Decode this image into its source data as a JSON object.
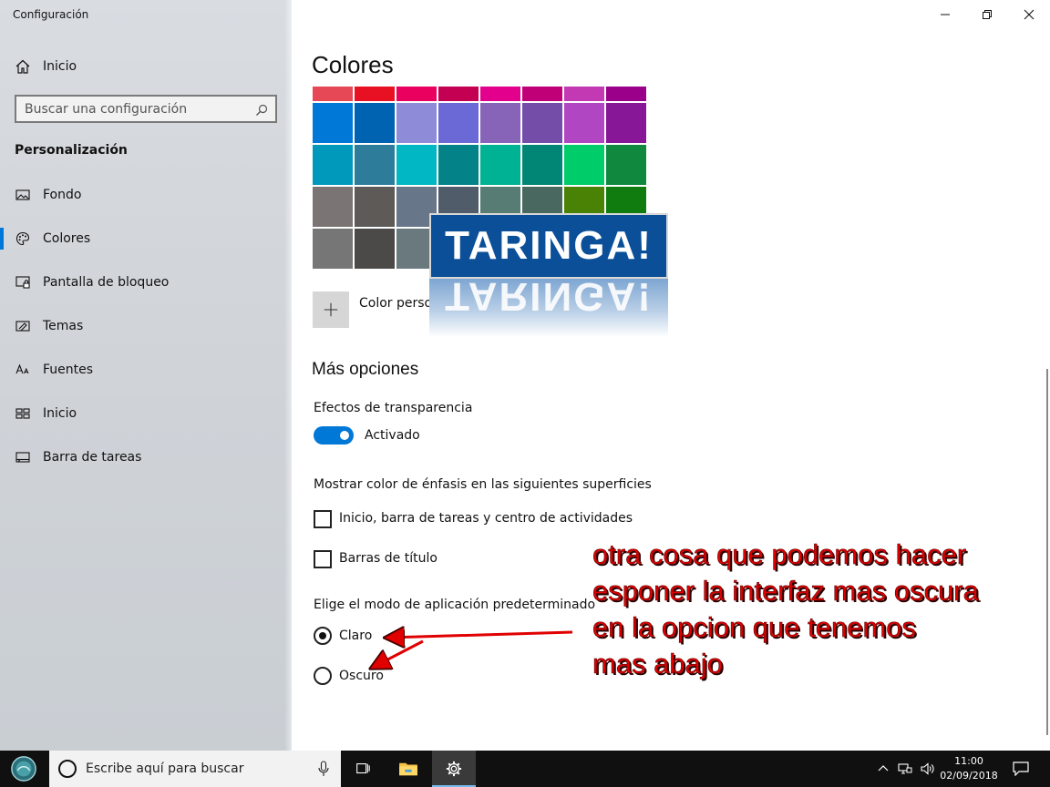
{
  "window": {
    "title": "Configuración"
  },
  "sidebar": {
    "home_label": "Inicio",
    "search_placeholder": "Buscar una configuración",
    "section_title": "Personalización",
    "items": [
      {
        "label": "Fondo",
        "icon": "image-icon"
      },
      {
        "label": "Colores",
        "icon": "palette-icon",
        "active": true
      },
      {
        "label": "Pantalla de bloqueo",
        "icon": "lock-screen-icon"
      },
      {
        "label": "Temas",
        "icon": "themes-icon"
      },
      {
        "label": "Fuentes",
        "icon": "fonts-icon"
      },
      {
        "label": "Inicio",
        "icon": "start-icon"
      },
      {
        "label": "Barra de tareas",
        "icon": "taskbar-icon"
      }
    ]
  },
  "main": {
    "title": "Colores",
    "swatch_rows": [
      [
        "#e74856",
        "#e81123",
        "#ea005e",
        "#c30052",
        "#e3008c",
        "#bf0077",
        "#c239b3",
        "#9a0089"
      ],
      [
        "#0078d7",
        "#0063b1",
        "#8e8cd8",
        "#6b69d6",
        "#8764b8",
        "#744da9",
        "#b146c2",
        "#881798"
      ],
      [
        "#0099bc",
        "#2d7d9a",
        "#00b7c3",
        "#038387",
        "#00b294",
        "#018574",
        "#00cc6a",
        "#10893e"
      ],
      [
        "#7a7574",
        "#5d5a58",
        "#68768a",
        "#515c6b",
        "#567c73",
        "#486860",
        "#498205",
        "#107c10"
      ],
      [
        "#767676",
        "#4c4a48",
        "#69797e",
        "#4a5459",
        "#647c64",
        "#525e54",
        "#847545",
        "#7e735f"
      ]
    ],
    "custom_color_label": "Color personalizado",
    "more_options_title": "Más opciones",
    "transparency_label": "Efectos de transparencia",
    "transparency_state": "Activado",
    "accent_surfaces_label": "Mostrar color de énfasis en las siguientes superficies",
    "checkbox_start": "Inicio, barra de tareas y centro de actividades",
    "checkbox_titlebars": "Barras de título",
    "app_mode_label": "Elige el modo de aplicación predeterminado",
    "mode_light": "Claro",
    "mode_dark": "Oscuro",
    "selected_mode": "Claro"
  },
  "logo": {
    "text": "TARINGA!"
  },
  "annotation": {
    "lines": [
      "otra cosa que podemos hacer",
      "esponer la interfaz mas oscura",
      "en la opcion que tenemos",
      "mas abajo"
    ],
    "color": "#e00000"
  },
  "taskbar": {
    "search_placeholder": "Escribe aquí para buscar",
    "time": "11:00",
    "date": "02/09/2018"
  },
  "colors": {
    "accent": "#0078d7",
    "taskbar": "#101010"
  }
}
